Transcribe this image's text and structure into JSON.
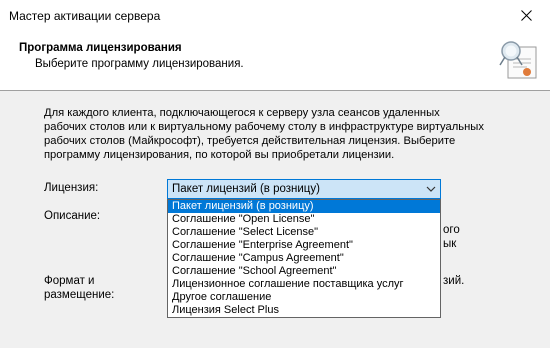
{
  "window": {
    "title": "Мастер активации сервера"
  },
  "header": {
    "title": "Программа лицензирования",
    "subtitle": "Выберите программу лицензирования.",
    "icon": "certificate-icon"
  },
  "body": {
    "description": "Для каждого клиента, подключающегося к серверу узла сеансов удаленных рабочих столов или к виртуальному рабочему столу в инфраструктуре виртуальных рабочих столов (Майкрософт), требуется действительная лицензия. Выберите программу лицензирования, по которой вы приобретали лицензии.",
    "license_label": "Лицензия:",
    "description_label": "Описание:",
    "format_label_line1": "Формат и",
    "format_label_line2": "размещение:",
    "clipped_right_1": "ого",
    "clipped_right_2": "ык",
    "clipped_right_3": "зий."
  },
  "combo": {
    "selected": "Пакет лицензий (в розницу)",
    "options": [
      "Пакет лицензий (в розницу)",
      "Соглашение \"Open License\"",
      "Соглашение \"Select License\"",
      "Соглашение \"Enterprise Agreement\"",
      "Соглашение \"Campus Agreement\"",
      "Соглашение \"School Agreement\"",
      "Лицензионное соглашение поставщика услуг",
      "Другое соглашение",
      "Лицензия Select Plus"
    ]
  },
  "colors": {
    "accent": "#0078d7",
    "combo_bg": "#cce4f7"
  }
}
